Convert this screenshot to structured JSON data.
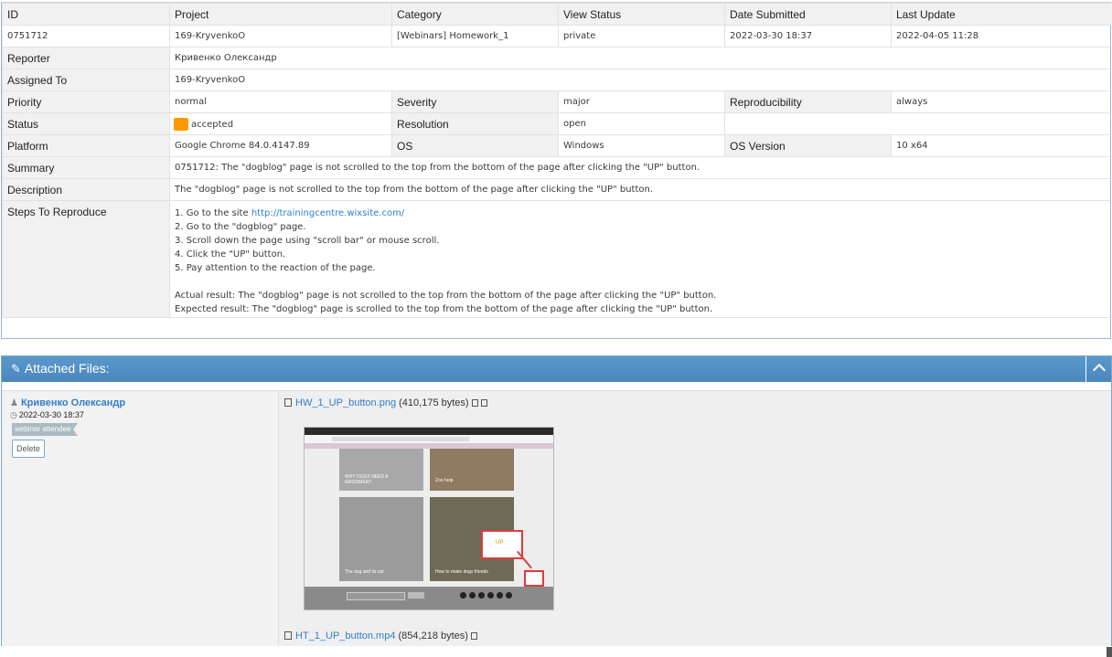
{
  "issue": {
    "headers": [
      "ID",
      "Project",
      "Category",
      "View Status",
      "Date Submitted",
      "Last Update"
    ],
    "values": [
      "0751712",
      "169-KryvenkoO",
      "[Webinars] Homework_1",
      "private",
      "2022-03-30 18:37",
      "2022-04-05 11:28"
    ],
    "reporter_label": "Reporter",
    "reporter": "Кривенко Олександр",
    "assigned_label": "Assigned To",
    "assigned": "169-KryvenkoO",
    "priority_label": "Priority",
    "priority": "normal",
    "severity_label": "Severity",
    "severity": "major",
    "reproducibility_label": "Reproducibility",
    "reproducibility": "always",
    "status_label": "Status",
    "status": "accepted",
    "status_color": "#ff9900",
    "resolution_label": "Resolution",
    "resolution": "open",
    "platform_label": "Platform",
    "platform": "Google Chrome 84.0.4147.89",
    "os_label": "OS",
    "os": "Windows",
    "os_version_label": "OS Version",
    "os_version": "10 x64",
    "summary_label": "Summary",
    "summary": "0751712: The \"dogblog\" page is not scrolled to the top from the bottom of the page after clicking the \"UP\" button.",
    "description_label": "Description",
    "description": "The \"dogblog\" page is not scrolled to the top from the bottom of the page after clicking the \"UP\" button.",
    "steps_label": "Steps To Reproduce",
    "steps": {
      "step1_prefix": "1. Go to the site ",
      "step1_link": "http://trainingcentre.wixsite.com/",
      "step2": "2. Go to the \"dogblog\" page.",
      "step3": "3. Scroll down the page using \"scroll bar\" or mouse scroll.",
      "step4": "4. Click the \"UP\" button.",
      "step5": "5. Pay attention to the reaction of the page.",
      "actual": "Actual result: The \"dogblog\" page is not scrolled to the top from the bottom of the page after clicking the \"UP\" button.",
      "expected": "Expected result: The \"dogblog\" page is scrolled to the top from the bottom of the page after clicking the \"UP\" button."
    }
  },
  "attachments": {
    "title": "Attached Files:",
    "icons": {
      "clip": "paperclip-icon",
      "collapse": "chevron-up-icon"
    },
    "author": "Кривенко Олександр",
    "date": "2022-03-30 18:37",
    "badge": "webinar attendee",
    "delete_label": "Delete",
    "files": [
      {
        "name": "HW_1_UP_button.png",
        "size": "(410,175 bytes)"
      },
      {
        "name": "HT_1_UP_button.mp4",
        "size": "(854,218 bytes)"
      }
    ],
    "thumbnail": {
      "card1": "WHY DOGS NEED A GROOMER?",
      "card2": "Zoo help",
      "card3": "The dog and its cat",
      "card4": "How to make dogs friends",
      "up_label": "UP"
    }
  }
}
